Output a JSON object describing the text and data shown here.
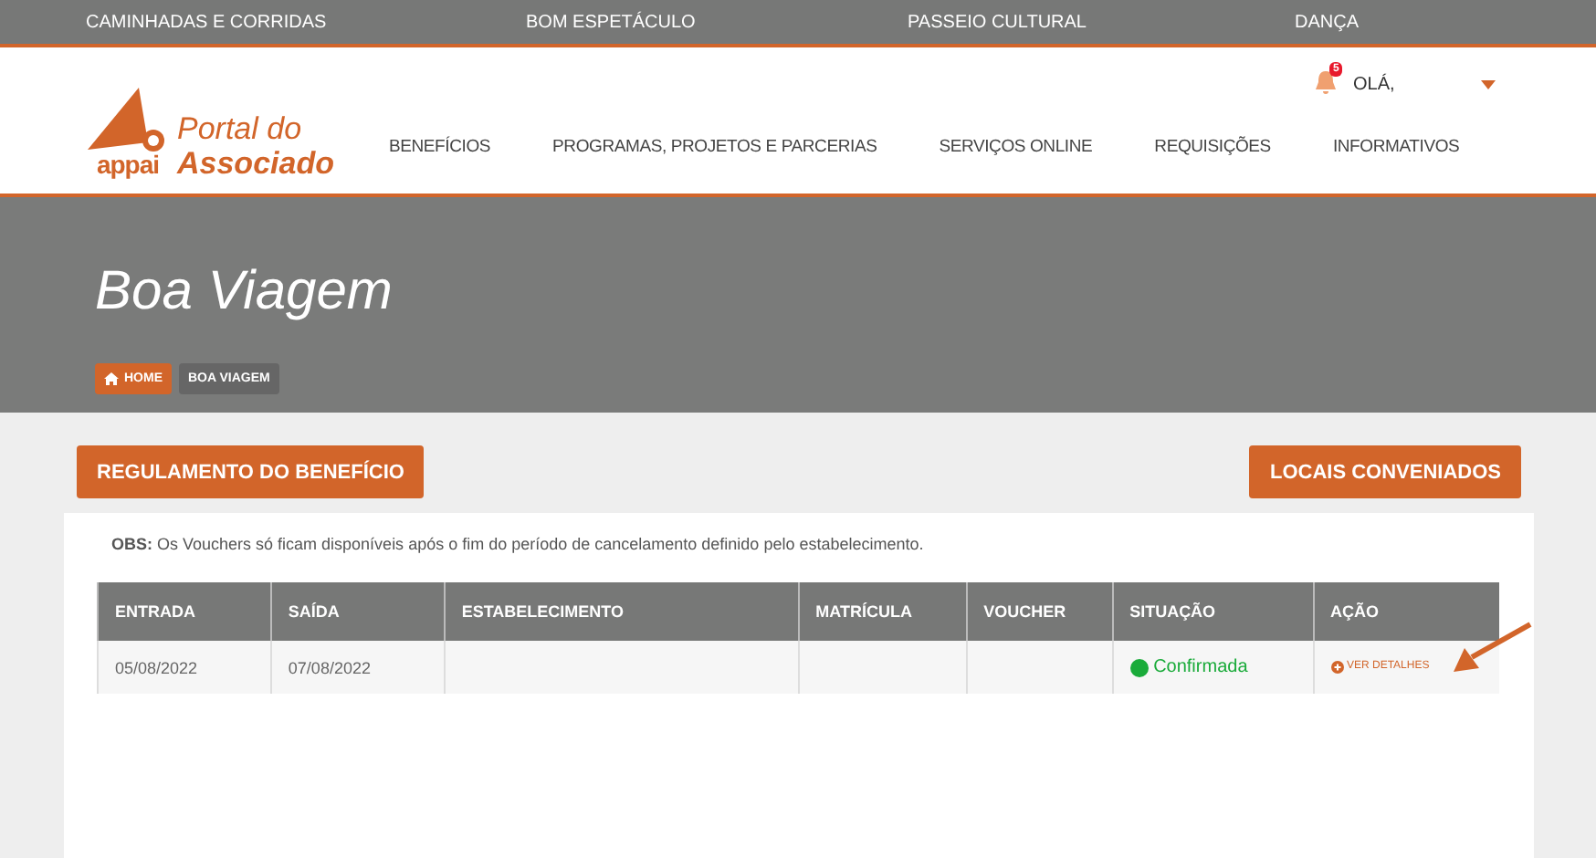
{
  "top_nav": [
    "CAMINHADAS E CORRIDAS",
    "BOM ESPETÁCULO",
    "PASSEIO CULTURAL",
    "DANÇA"
  ],
  "logo": {
    "brand": "appai",
    "line1": "Portal do",
    "line2": "Associado"
  },
  "main_nav": [
    "BENEFÍCIOS",
    "PROGRAMAS, PROJETOS E PARCERIAS",
    "SERVIÇOS ONLINE",
    "REQUISIÇÕES",
    "INFORMATIVOS"
  ],
  "user": {
    "notification_count": "5",
    "greeting": "OLÁ,"
  },
  "banner": {
    "title": "Boa Viagem",
    "breadcrumb": [
      {
        "label": "HOME",
        "kind": "home"
      },
      {
        "label": "BOA VIAGEM",
        "kind": "current"
      }
    ]
  },
  "buttons": [
    "REGULAMENTO DO BENEFÍCIO",
    "LOCAIS CONVENIADOS"
  ],
  "obs": "**OBS:** Os Vouchers só ficam disponíveis após o fim do período de cancelamento definido pelo estabelecimento.",
  "table": {
    "columns": [
      "ENTRADA",
      "SAÍDA",
      "ESTABELECIMENTO",
      "MATRÍCULA",
      "VOUCHER",
      "SITUAÇÃO",
      "AÇÃO"
    ],
    "rows": [
      {
        "entrada": "05/08/2022",
        "saida": "07/08/2022",
        "situacao": {
          "text": "Confirmada",
          "color": "#1aab3a"
        },
        "acao": "VER DETALHES"
      }
    ]
  }
}
